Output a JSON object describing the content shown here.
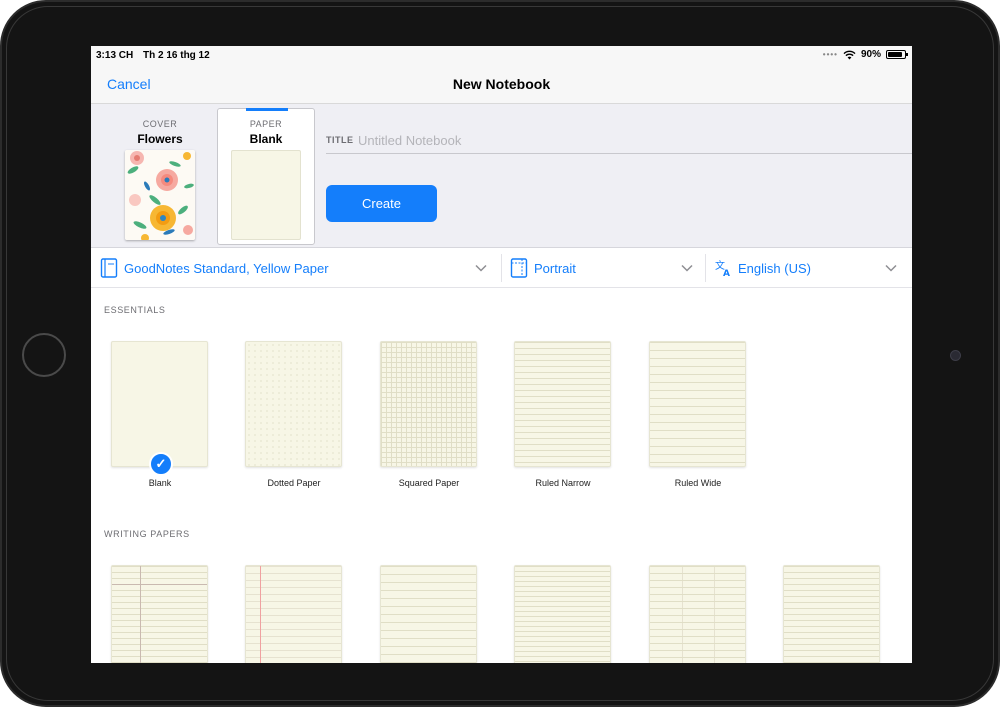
{
  "status_bar": {
    "time": "3:13 CH",
    "date": "Th 2 16 thg 12",
    "battery": "90%",
    "battery_level": 0.9,
    "signal_dots": "••••"
  },
  "nav": {
    "cancel_label": "Cancel",
    "title": "New Notebook"
  },
  "cover": {
    "caption": "COVER",
    "name": "Flowers"
  },
  "paper": {
    "caption": "PAPER",
    "name": "Blank"
  },
  "title_field": {
    "label": "TITLE",
    "placeholder": "Untitled Notebook",
    "value": ""
  },
  "create_label": "Create",
  "selectors": {
    "template_set": "GoodNotes Standard, Yellow Paper",
    "orientation": "Portrait",
    "language": "English (US)"
  },
  "sections": [
    {
      "header": "ESSENTIALS",
      "templates": [
        {
          "label": "Blank",
          "style": "blank",
          "selected": true
        },
        {
          "label": "Dotted Paper",
          "style": "dotted",
          "selected": false
        },
        {
          "label": "Squared Paper",
          "style": "squared",
          "selected": false
        },
        {
          "label": "Ruled Narrow",
          "style": "ruled-narrow",
          "selected": false
        },
        {
          "label": "Ruled Wide",
          "style": "ruled-wide",
          "selected": false
        }
      ]
    },
    {
      "header": "WRITING PAPERS",
      "templates": [
        {
          "label": "",
          "style": "legal",
          "selected": false
        },
        {
          "label": "",
          "style": "margin-red",
          "selected": false
        },
        {
          "label": "",
          "style": "ruled-wide2",
          "selected": false
        },
        {
          "label": "",
          "style": "ruled-narrow2",
          "selected": false
        },
        {
          "label": "",
          "style": "columns",
          "selected": false
        },
        {
          "label": "",
          "style": "ruled-narrow",
          "selected": false
        }
      ]
    }
  ],
  "colors": {
    "accent": "#147efb",
    "paper": "#f7f6e6",
    "background": "#efeff4"
  },
  "icons": {
    "wifi": "wifi-icon",
    "battery": "battery-icon",
    "template": "template-icon",
    "orientation": "portrait-icon",
    "language": "translate-icon",
    "chevron": "chevron-down-icon",
    "check": "checkmark-icon"
  }
}
